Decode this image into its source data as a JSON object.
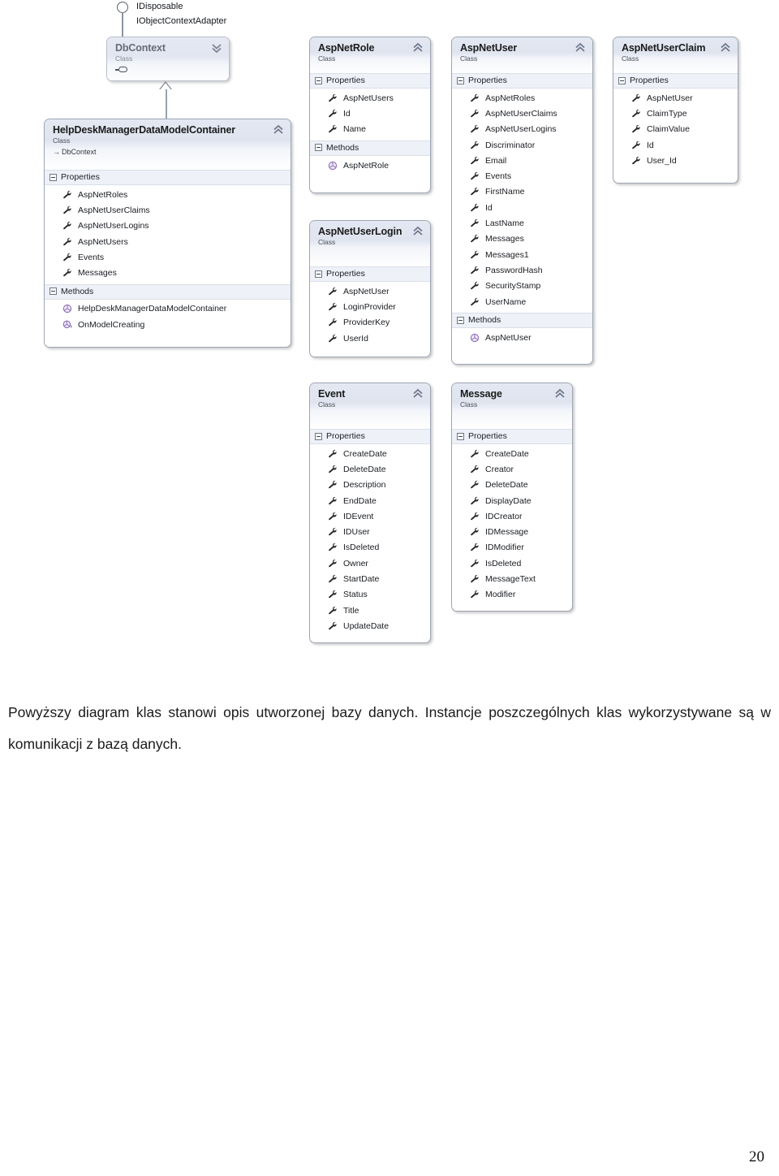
{
  "document": {
    "page_number": "20",
    "paragraph": "Powyższy diagram klas stanowi opis utworzonej bazy danych. Instancje poszczególnych klas wykorzystywane są w komunikacji z bazą danych."
  },
  "diagram": {
    "type": "uml-class-diagram",
    "stereotype_label": "Class",
    "compartments": {
      "properties": "Properties",
      "methods": "Methods"
    },
    "interfaces": [
      {
        "name": "IDisposable"
      },
      {
        "name": "IObjectContextAdapter"
      }
    ],
    "classes": [
      {
        "id": "dbcontext",
        "name": "DbContext",
        "stereotype": "Class",
        "collapsed": true,
        "dimmed": true,
        "chevron": "chevron-down-icon",
        "base": null,
        "properties": [],
        "methods": []
      },
      {
        "id": "helpdeskmanagerdatamodelcontainer",
        "name": "HelpDeskManagerDataModelContainer",
        "stereotype": "Class",
        "collapsed": false,
        "dimmed": false,
        "chevron": "chevron-up-icon",
        "base": "DbContext",
        "properties": [
          "AspNetRoles",
          "AspNetUserClaims",
          "AspNetUserLogins",
          "AspNetUsers",
          "Events",
          "Messages"
        ],
        "methods": [
          {
            "name": "HelpDeskManagerDataModelContainer",
            "static_marker": false
          },
          {
            "name": "OnModelCreating",
            "static_marker": true
          }
        ]
      },
      {
        "id": "aspnetrole",
        "name": "AspNetRole",
        "stereotype": "Class",
        "collapsed": false,
        "dimmed": false,
        "chevron": "chevron-up-icon",
        "base": null,
        "properties": [
          "AspNetUsers",
          "Id",
          "Name"
        ],
        "methods": [
          {
            "name": "AspNetRole",
            "static_marker": false
          }
        ]
      },
      {
        "id": "aspnetuser",
        "name": "AspNetUser",
        "stereotype": "Class",
        "collapsed": false,
        "dimmed": false,
        "chevron": "chevron-up-icon",
        "base": null,
        "properties": [
          "AspNetRoles",
          "AspNetUserClaims",
          "AspNetUserLogins",
          "Discriminator",
          "Email",
          "Events",
          "FirstName",
          "Id",
          "LastName",
          "Messages",
          "Messages1",
          "PasswordHash",
          "SecurityStamp",
          "UserName"
        ],
        "methods": [
          {
            "name": "AspNetUser",
            "static_marker": false
          }
        ]
      },
      {
        "id": "aspnetuserclaim",
        "name": "AspNetUserClaim",
        "stereotype": "Class",
        "collapsed": false,
        "dimmed": false,
        "chevron": "chevron-up-icon",
        "base": null,
        "properties": [
          "AspNetUser",
          "ClaimType",
          "ClaimValue",
          "Id",
          "User_Id"
        ],
        "methods": []
      },
      {
        "id": "aspnetuserlogin",
        "name": "AspNetUserLogin",
        "stereotype": "Class",
        "collapsed": false,
        "dimmed": false,
        "chevron": "chevron-up-icon",
        "base": null,
        "properties": [
          "AspNetUser",
          "LoginProvider",
          "ProviderKey",
          "UserId"
        ],
        "methods": []
      },
      {
        "id": "event",
        "name": "Event",
        "stereotype": "Class",
        "collapsed": false,
        "dimmed": false,
        "chevron": "chevron-up-icon",
        "base": null,
        "properties": [
          "CreateDate",
          "DeleteDate",
          "Description",
          "EndDate",
          "IDEvent",
          "IDUser",
          "IsDeleted",
          "Owner",
          "StartDate",
          "Status",
          "Title",
          "UpdateDate"
        ],
        "methods": []
      },
      {
        "id": "message",
        "name": "Message",
        "stereotype": "Class",
        "collapsed": false,
        "dimmed": false,
        "chevron": "chevron-up-icon",
        "base": null,
        "properties": [
          "CreateDate",
          "Creator",
          "DeleteDate",
          "DisplayDate",
          "IDCreator",
          "IDMessage",
          "IDModifier",
          "IsDeleted",
          "MessageText",
          "Modifier"
        ],
        "methods": []
      }
    ],
    "relationships": [
      {
        "kind": "generalization",
        "from": "HelpDeskManagerDataModelContainer",
        "to": "DbContext"
      },
      {
        "kind": "realization",
        "from": "DbContext",
        "to": "IDisposable"
      },
      {
        "kind": "realization",
        "from": "DbContext",
        "to": "IObjectContextAdapter"
      }
    ],
    "colors": {
      "header_gradient_top": "#e3e8f2",
      "header_gradient_bottom": "#ffffff",
      "compartment_bg": "#eef1f8",
      "border": "#9fa6b4",
      "property_icon": "#2b2b2b",
      "method_icon": "#8e6fb5",
      "connector": "#9aa2b0"
    }
  }
}
